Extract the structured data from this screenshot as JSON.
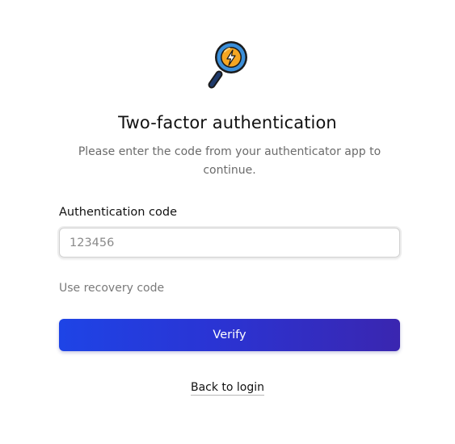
{
  "logo": {
    "icon": "magnifier-lightning-icon",
    "colors": {
      "lens_fill": "#f5a623",
      "lens_ring": "#3b8fd9",
      "bolt": "#ffffff",
      "handle": "#1f3a6b",
      "outline": "#1a1a1a"
    }
  },
  "header": {
    "title": "Two-factor authentication",
    "subtitle": "Please enter the code from your authenticator app to continue."
  },
  "form": {
    "code_label": "Authentication code",
    "code_value": "",
    "code_placeholder": "123456",
    "recovery_link": "Use recovery code",
    "verify_button": "Verify"
  },
  "footer": {
    "back_link": "Back to login"
  },
  "theme": {
    "button_gradient_start": "#1e44e6",
    "button_gradient_end": "#3a26b0",
    "muted_text": "#6b6b6b"
  }
}
